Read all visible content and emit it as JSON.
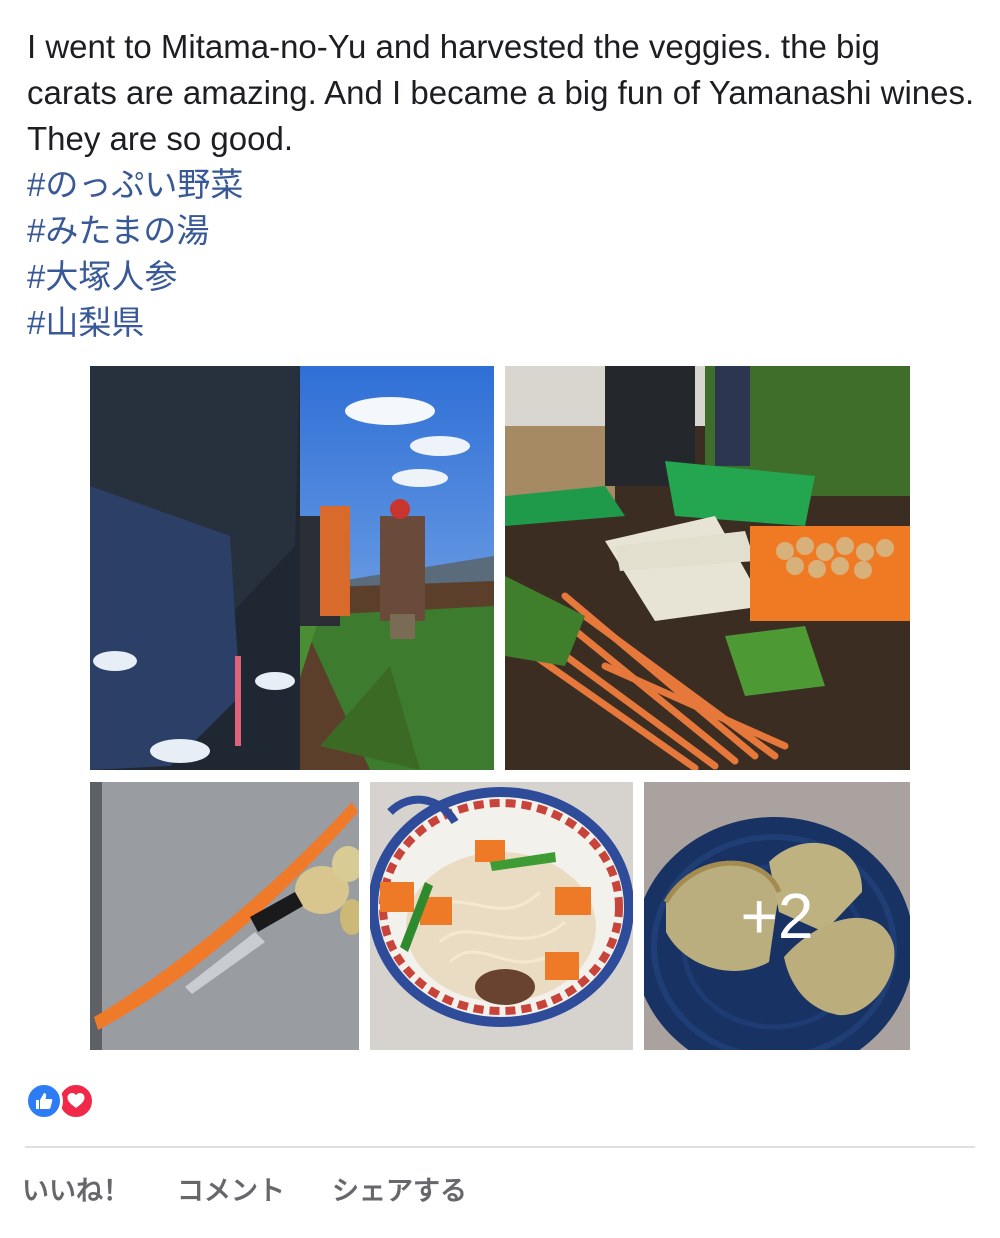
{
  "post": {
    "body": "I went to Mitama-no-Yu and harvested the veggies. the big carats are amazing. And I became a big fun of Yamanashi wines. They are so good.",
    "hashtags": [
      "#のっぷい野菜",
      "#みたまの湯",
      "#大塚人参",
      "#山梨県"
    ]
  },
  "gallery": {
    "more_count_label": "+2"
  },
  "reactions": {
    "icons": [
      "like-icon",
      "love-icon"
    ]
  },
  "actions": {
    "like_label": "いいね！",
    "comment_label": "コメント",
    "share_label": "シェアする"
  },
  "colors": {
    "hashtag": "#385898",
    "like_blue": "#2e7bf6",
    "love_red": "#f0284a",
    "action_gray": "#65676b"
  }
}
